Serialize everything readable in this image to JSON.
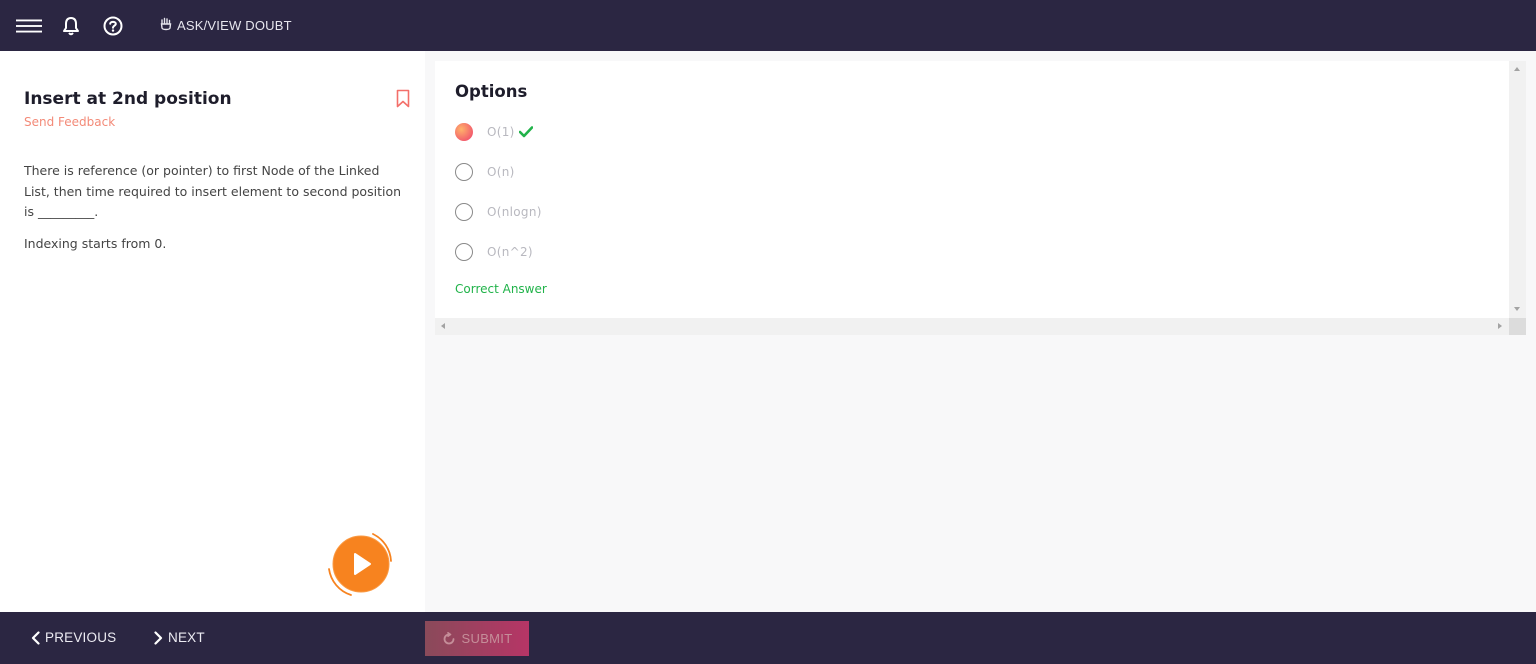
{
  "topbar": {
    "ask_label": "ASK/VIEW DOUBT"
  },
  "question": {
    "title": "Insert at 2nd position",
    "feedback_link": "Send Feedback",
    "text": "There is reference (or pointer) to first Node of the Linked List, then time required to insert element to second position is _________.",
    "note": "Indexing starts from 0."
  },
  "options_panel": {
    "title": "Options",
    "options": [
      {
        "label": "O(1)",
        "selected": true,
        "correct": true
      },
      {
        "label": "O(n)",
        "selected": false,
        "correct": false
      },
      {
        "label": "O(nlogn)",
        "selected": false,
        "correct": false
      },
      {
        "label": "O(n^2)",
        "selected": false,
        "correct": false
      }
    ],
    "result_text": "Correct Answer"
  },
  "bottombar": {
    "previous_label": "PREVIOUS",
    "next_label": "NEXT",
    "submit_label": "SUBMIT"
  },
  "colors": {
    "bar": "#2b2642",
    "accent_orange": "#f7831f",
    "correct_green": "#21b34a",
    "feedback_pink": "#f38a78"
  },
  "icons": [
    "menu-icon",
    "bell-icon",
    "help-icon",
    "hand-icon",
    "bookmark-icon",
    "play-icon",
    "check-icon",
    "chevron-left-icon",
    "chevron-right-icon",
    "refresh-icon"
  ]
}
